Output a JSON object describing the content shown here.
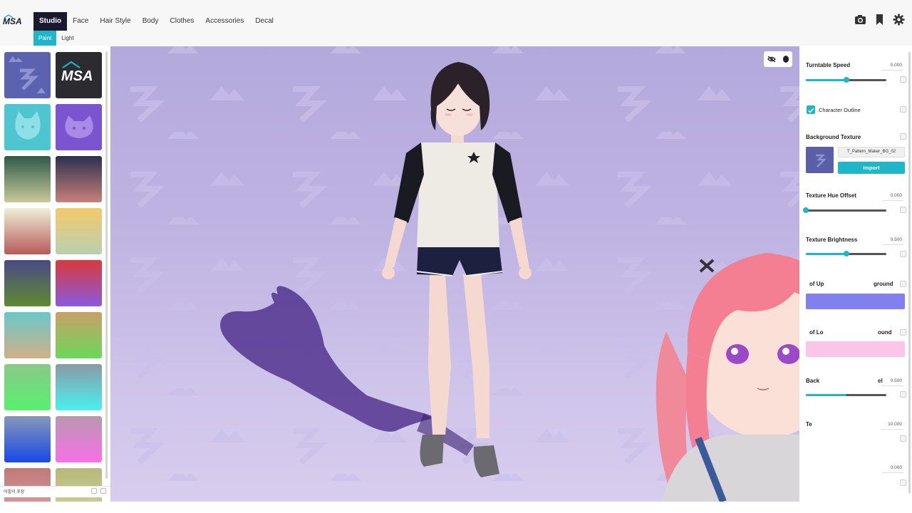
{
  "topbar": {
    "tabs": [
      {
        "label": "Studio",
        "active": true
      },
      {
        "label": "Face",
        "active": false
      },
      {
        "label": "Hair Style",
        "active": false
      },
      {
        "label": "Body",
        "active": false
      },
      {
        "label": "Clothes",
        "active": false
      },
      {
        "label": "Accessories",
        "active": false
      },
      {
        "label": "Decal",
        "active": false
      }
    ],
    "icons": [
      "camera-icon",
      "bookmark-icon",
      "gear-icon"
    ]
  },
  "subtabs": [
    {
      "label": "Paint",
      "active": true
    },
    {
      "label": "Light",
      "active": false
    }
  ],
  "left_panel": {
    "footer_text": "어필의 포장"
  },
  "right_panel": {
    "turntable_speed": {
      "label": "Turntable Speed",
      "value": "0.000",
      "level": 0.5
    },
    "character_outline": {
      "label": "Character Outline",
      "checked": true
    },
    "background_texture": {
      "label": "Background Texture",
      "texture_name": "T_Pattern_Maker_BG_02",
      "import_label": "Import"
    },
    "texture_hue_offset": {
      "label": "Texture Hue Offset",
      "value": "0.000",
      "level": 0.0
    },
    "texture_brightness": {
      "label": "Texture Brightness",
      "value": "0.500",
      "level": 0.5
    },
    "upper_bg": {
      "label_fragment": "of Up",
      "label_fragment2": "ground",
      "color": "#8080ee"
    },
    "lower_bg": {
      "label_fragment": "of Lo",
      "label_fragment2": "ound",
      "color": "#fcc4e8"
    },
    "bg_level": {
      "label_fragment": "Back",
      "label_fragment2": "el",
      "value": "0.500"
    },
    "tex_row": {
      "label_fragment": "Te",
      "value": "10.000"
    },
    "last_row": {
      "value": "0.000"
    }
  },
  "colors": {
    "accent": "#1fb6c9",
    "active_tab": "#1a1a2e",
    "viewport_bg": "#bfb3e2"
  }
}
